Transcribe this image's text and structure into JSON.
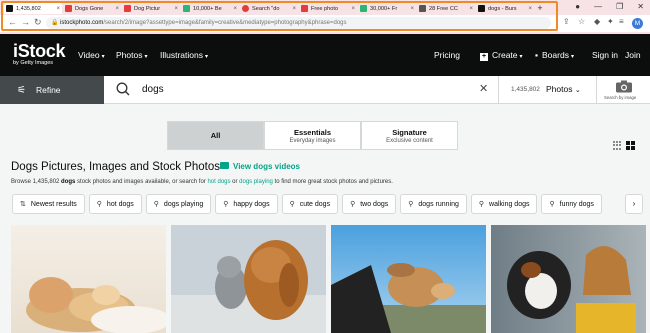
{
  "browser": {
    "tabs": [
      {
        "title": "1,435,802",
        "color": "#111111",
        "active": true
      },
      {
        "title": "Dogs Gone",
        "color": "#e43b3b"
      },
      {
        "title": "Dog Pictur",
        "color": "#e43b3b"
      },
      {
        "title": "10,000+ Be",
        "color": "#2bb673"
      },
      {
        "title": "Search \"do",
        "color": "#e43b3b"
      },
      {
        "title": "Free photo",
        "color": "#e43b3b"
      },
      {
        "title": "30,000+ Fr",
        "color": "#2bb673"
      },
      {
        "title": "28 Free CC",
        "color": "#555555"
      },
      {
        "title": "dogs - Burs",
        "color": "#111111"
      }
    ],
    "new_tab": "+",
    "url_host": "istockphoto.com",
    "url_path": "/search/2/image?assettype=image&family=creative&mediatype=photography&phrase=dogs",
    "profile_initial": "M"
  },
  "header": {
    "logo": "iStock",
    "logo_sub": "by Getty Images",
    "nav": [
      "Video",
      "Photos",
      "Illustrations"
    ],
    "pricing": "Pricing",
    "create": "Create",
    "boards": "Boards",
    "signin": "Sign in",
    "join": "Join"
  },
  "search": {
    "refine": "Refine",
    "query": "dogs",
    "count": "1,435,802",
    "type": "Photos",
    "image_search": "Search by image"
  },
  "content_tabs": [
    {
      "label": "All",
      "sub": ""
    },
    {
      "label": "Essentials",
      "sub": "Everyday images"
    },
    {
      "label": "Signature",
      "sub": "Exclusive content"
    }
  ],
  "page": {
    "title": "Dogs Pictures, Images and Stock Photos",
    "video_link": "View dogs videos",
    "browse_prefix": "Browse 1,435,802 ",
    "browse_bold": "dogs",
    "browse_mid": " stock photos and images available, or search for ",
    "link1": "hot dogs",
    "browse_or": " or ",
    "link2": "dogs playing",
    "browse_suffix": " to find more great stock photos and pictures."
  },
  "chips": [
    {
      "label": "Newest results",
      "icon": "sliders-icon"
    },
    {
      "label": "hot dogs",
      "icon": "search-icon"
    },
    {
      "label": "dogs playing",
      "icon": "search-icon"
    },
    {
      "label": "happy dogs",
      "icon": "search-icon"
    },
    {
      "label": "cute dogs",
      "icon": "search-icon"
    },
    {
      "label": "two dogs",
      "icon": "search-icon"
    },
    {
      "label": "dogs running",
      "icon": "search-icon"
    },
    {
      "label": "walking dogs",
      "icon": "search-icon"
    },
    {
      "label": "funny dogs",
      "icon": "search-icon"
    }
  ],
  "colors": {
    "accent": "#02a388",
    "header_bg": "#0c0d0d",
    "refine_bg": "#444a4c",
    "highlight": "#f08a24"
  }
}
